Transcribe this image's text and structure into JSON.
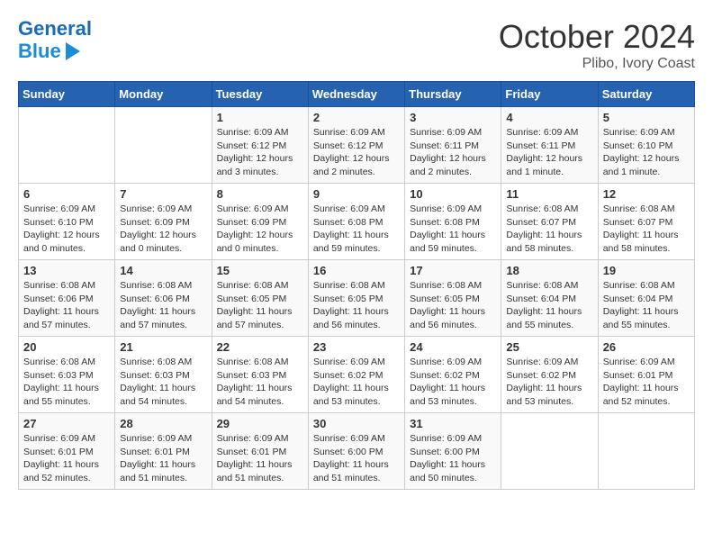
{
  "header": {
    "logo_line1": "General",
    "logo_line2": "Blue",
    "month": "October 2024",
    "location": "Plibo, Ivory Coast"
  },
  "days_of_week": [
    "Sunday",
    "Monday",
    "Tuesday",
    "Wednesday",
    "Thursday",
    "Friday",
    "Saturday"
  ],
  "weeks": [
    [
      {
        "day": "",
        "info": ""
      },
      {
        "day": "",
        "info": ""
      },
      {
        "day": "1",
        "info": "Sunrise: 6:09 AM\nSunset: 6:12 PM\nDaylight: 12 hours\nand 3 minutes."
      },
      {
        "day": "2",
        "info": "Sunrise: 6:09 AM\nSunset: 6:12 PM\nDaylight: 12 hours\nand 2 minutes."
      },
      {
        "day": "3",
        "info": "Sunrise: 6:09 AM\nSunset: 6:11 PM\nDaylight: 12 hours\nand 2 minutes."
      },
      {
        "day": "4",
        "info": "Sunrise: 6:09 AM\nSunset: 6:11 PM\nDaylight: 12 hours\nand 1 minute."
      },
      {
        "day": "5",
        "info": "Sunrise: 6:09 AM\nSunset: 6:10 PM\nDaylight: 12 hours\nand 1 minute."
      }
    ],
    [
      {
        "day": "6",
        "info": "Sunrise: 6:09 AM\nSunset: 6:10 PM\nDaylight: 12 hours\nand 0 minutes."
      },
      {
        "day": "7",
        "info": "Sunrise: 6:09 AM\nSunset: 6:09 PM\nDaylight: 12 hours\nand 0 minutes."
      },
      {
        "day": "8",
        "info": "Sunrise: 6:09 AM\nSunset: 6:09 PM\nDaylight: 12 hours\nand 0 minutes."
      },
      {
        "day": "9",
        "info": "Sunrise: 6:09 AM\nSunset: 6:08 PM\nDaylight: 11 hours\nand 59 minutes."
      },
      {
        "day": "10",
        "info": "Sunrise: 6:09 AM\nSunset: 6:08 PM\nDaylight: 11 hours\nand 59 minutes."
      },
      {
        "day": "11",
        "info": "Sunrise: 6:08 AM\nSunset: 6:07 PM\nDaylight: 11 hours\nand 58 minutes."
      },
      {
        "day": "12",
        "info": "Sunrise: 6:08 AM\nSunset: 6:07 PM\nDaylight: 11 hours\nand 58 minutes."
      }
    ],
    [
      {
        "day": "13",
        "info": "Sunrise: 6:08 AM\nSunset: 6:06 PM\nDaylight: 11 hours\nand 57 minutes."
      },
      {
        "day": "14",
        "info": "Sunrise: 6:08 AM\nSunset: 6:06 PM\nDaylight: 11 hours\nand 57 minutes."
      },
      {
        "day": "15",
        "info": "Sunrise: 6:08 AM\nSunset: 6:05 PM\nDaylight: 11 hours\nand 57 minutes."
      },
      {
        "day": "16",
        "info": "Sunrise: 6:08 AM\nSunset: 6:05 PM\nDaylight: 11 hours\nand 56 minutes."
      },
      {
        "day": "17",
        "info": "Sunrise: 6:08 AM\nSunset: 6:05 PM\nDaylight: 11 hours\nand 56 minutes."
      },
      {
        "day": "18",
        "info": "Sunrise: 6:08 AM\nSunset: 6:04 PM\nDaylight: 11 hours\nand 55 minutes."
      },
      {
        "day": "19",
        "info": "Sunrise: 6:08 AM\nSunset: 6:04 PM\nDaylight: 11 hours\nand 55 minutes."
      }
    ],
    [
      {
        "day": "20",
        "info": "Sunrise: 6:08 AM\nSunset: 6:03 PM\nDaylight: 11 hours\nand 55 minutes."
      },
      {
        "day": "21",
        "info": "Sunrise: 6:08 AM\nSunset: 6:03 PM\nDaylight: 11 hours\nand 54 minutes."
      },
      {
        "day": "22",
        "info": "Sunrise: 6:08 AM\nSunset: 6:03 PM\nDaylight: 11 hours\nand 54 minutes."
      },
      {
        "day": "23",
        "info": "Sunrise: 6:09 AM\nSunset: 6:02 PM\nDaylight: 11 hours\nand 53 minutes."
      },
      {
        "day": "24",
        "info": "Sunrise: 6:09 AM\nSunset: 6:02 PM\nDaylight: 11 hours\nand 53 minutes."
      },
      {
        "day": "25",
        "info": "Sunrise: 6:09 AM\nSunset: 6:02 PM\nDaylight: 11 hours\nand 53 minutes."
      },
      {
        "day": "26",
        "info": "Sunrise: 6:09 AM\nSunset: 6:01 PM\nDaylight: 11 hours\nand 52 minutes."
      }
    ],
    [
      {
        "day": "27",
        "info": "Sunrise: 6:09 AM\nSunset: 6:01 PM\nDaylight: 11 hours\nand 52 minutes."
      },
      {
        "day": "28",
        "info": "Sunrise: 6:09 AM\nSunset: 6:01 PM\nDaylight: 11 hours\nand 51 minutes."
      },
      {
        "day": "29",
        "info": "Sunrise: 6:09 AM\nSunset: 6:01 PM\nDaylight: 11 hours\nand 51 minutes."
      },
      {
        "day": "30",
        "info": "Sunrise: 6:09 AM\nSunset: 6:00 PM\nDaylight: 11 hours\nand 51 minutes."
      },
      {
        "day": "31",
        "info": "Sunrise: 6:09 AM\nSunset: 6:00 PM\nDaylight: 11 hours\nand 50 minutes."
      },
      {
        "day": "",
        "info": ""
      },
      {
        "day": "",
        "info": ""
      }
    ]
  ]
}
